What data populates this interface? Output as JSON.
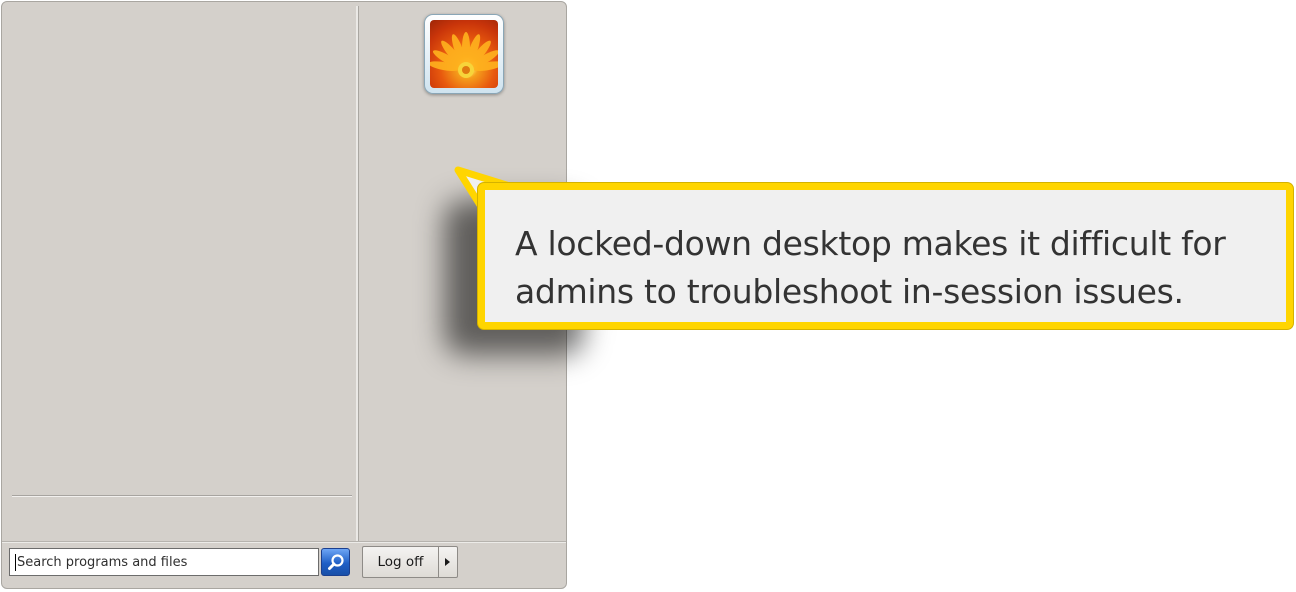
{
  "start_menu": {
    "search": {
      "placeholder": "Search programs and files"
    },
    "logoff": {
      "label": "Log off"
    },
    "user_picture": "flower-user-picture"
  },
  "callout": {
    "text": "A locked-down desktop makes it difficult for admins to troubleshoot in-session issues."
  },
  "colors": {
    "callout_border": "#ffd500",
    "callout_fill": "#f0f0f0",
    "menu_background": "#d4d0cb",
    "search_button": "#1f5fc6"
  },
  "icons": {
    "search_button": "search-icon",
    "logoff_arrow": "triangle-right-icon"
  }
}
